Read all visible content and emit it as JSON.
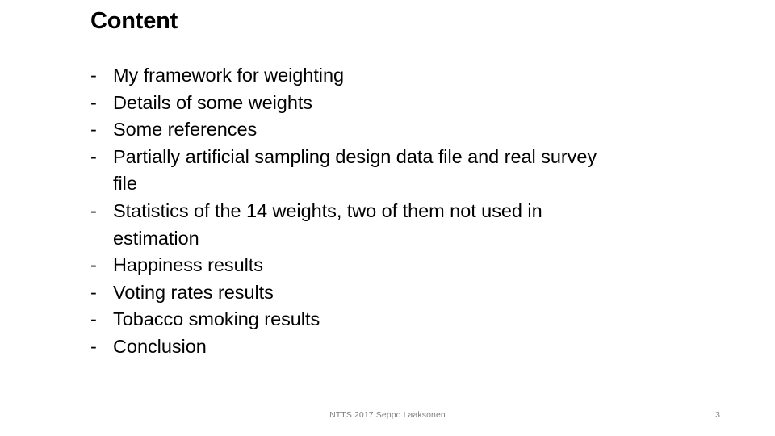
{
  "slide": {
    "title": "Content",
    "background_color": "#ffffff",
    "text_color": "#000000",
    "footer_color": "#808080",
    "bullet_marker": "-",
    "bullets": [
      {
        "text": "My framework for weighting"
      },
      {
        "text": "Details of some weights"
      },
      {
        "text": "Some references"
      },
      {
        "text": "Partially artificial sampling design data file and real survey file"
      },
      {
        "text": "Statistics of the 14 weights, two of them not used in estimation"
      },
      {
        "text": "Happiness results"
      },
      {
        "text": "Voting rates results"
      },
      {
        "text": "Tobacco smoking results"
      },
      {
        "text": "Conclusion"
      }
    ],
    "footer": "NTTS 2017 Seppo Laaksonen",
    "page_number": "3"
  }
}
